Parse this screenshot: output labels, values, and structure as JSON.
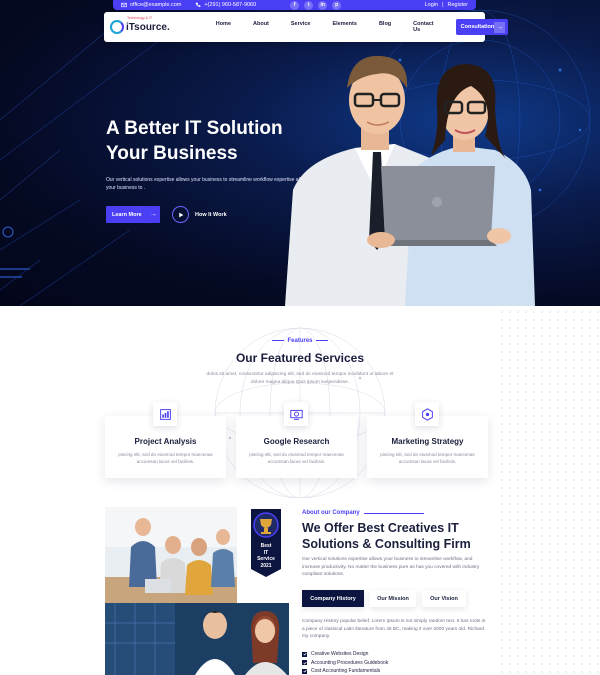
{
  "topbar": {
    "email": "office@example.com",
    "phone": "+(291) 960-587-9060",
    "social": [
      "f",
      "t",
      "in",
      "p"
    ],
    "login": "Login",
    "separator": "|",
    "register": "Register"
  },
  "nav": {
    "logo_text": "iTsource.",
    "logo_tag": "Technology & IT",
    "links": [
      "Home",
      "About",
      "Service",
      "Elements",
      "Blog",
      "Contact Us"
    ],
    "cta": "Consultation",
    "cta_icon": "arrow-right-icon"
  },
  "hero": {
    "title_line1": "A Better IT Solution",
    "title_line2": "Your Business",
    "description": "Our vertical solutions expertise allows your business to streamline workflow expertise allows your business to .",
    "primary_button": "Learn More",
    "video_label": "How It Work"
  },
  "features": {
    "kicker": "Features",
    "title": "Our Featured Services",
    "description": "dolos sit amet, consectetur adipiscing elit, sed do eiusmod tempor incididunt ut labore et dolore magna aliqua Quis ipsum suspendisse.",
    "cards": [
      {
        "title": "Project Analysis",
        "text": "piscing elit, sed do eiusmod tempor maecenas accumsan lacus vel facilisis.",
        "icon": "analysis-icon"
      },
      {
        "title": "Google Research",
        "text": "piscing elit, sed do eiusmod tempor maecenas accumsan lacus vel facilisis.",
        "icon": "research-icon"
      },
      {
        "title": "Marketing Strategy",
        "text": "piscing elit, sed do eiusmod tempor maecenas accumsan lacus vel facilisis.",
        "icon": "strategy-icon"
      }
    ]
  },
  "about": {
    "award_line1": "Best",
    "award_line2": "IT",
    "award_line3": "Service",
    "award_year": "2021",
    "kicker": "About our Company",
    "title": "We Offer Best Creatives IT Solutions & Consulting Firm",
    "description": "Our vertical solutions expertise allows your business to streamline workflow, and increase productivity. No matter the business pure as has you covered with industry compliant solutions.",
    "tabs": [
      "Company History",
      "Our Mission",
      "Our Vision"
    ],
    "history": "Company History popular belief, Lorem Ipsum is not simply random text. It has roots in a piece of classical Latin literature from 45 BC, making it over 2000 years old. Richard my company.",
    "list": [
      "Creative Websites Design",
      "Accounting Procedures Guidebook",
      "Cost Accounting Fundamentals"
    ]
  },
  "colors": {
    "brand": "#4b3ff5",
    "navy": "#0c1440",
    "hero_bg": "#050a24"
  }
}
